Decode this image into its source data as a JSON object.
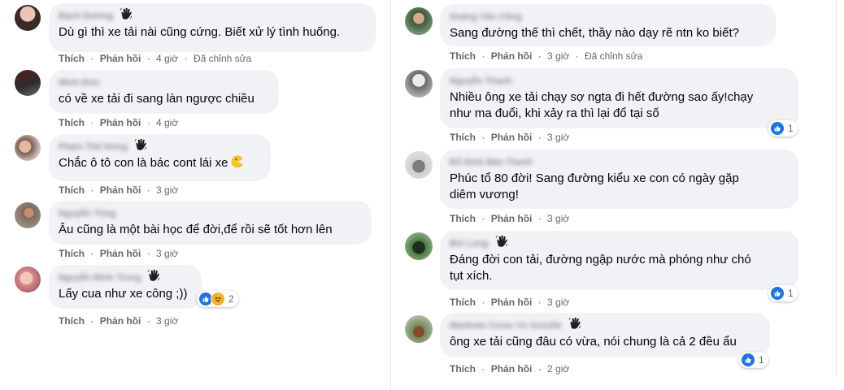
{
  "reactions_color": "#1b74e4",
  "left": [
    {
      "name": "Bạch Dương",
      "text": "Dù gì thì xe tải nài cũng cứng. Biết xử lý tình huống.",
      "like": "Thích",
      "reply": "Phản hồi",
      "time": "4 giờ",
      "edited": "Đã chỉnh sửa"
    },
    {
      "name": "Minh Đức",
      "text": "có về xe tải đi sang làn ngược chiều",
      "like": "Thích",
      "reply": "Phản hồi",
      "time": "4 giờ"
    },
    {
      "name": "Phạm Thế Hưng",
      "text": "Chắc ô tô con là bác cont lái xe",
      "like": "Thích",
      "reply": "Phản hồi",
      "time": "3 giờ"
    },
    {
      "name": "Nguyễn Tùng",
      "text": "Âu cũng là một bài học để đời,để rồi sẽ tốt hơn lên",
      "like": "Thích",
      "reply": "Phản hồi",
      "time": "3 giờ"
    },
    {
      "name": "Nguyễn Đình Trung",
      "text": "Lấy cua như xe công ;))",
      "like": "Thích",
      "reply": "Phản hồi",
      "time": "3 giờ",
      "reaction_count": "2"
    }
  ],
  "right": [
    {
      "name": "Hoàng Văn Công",
      "text": "Sang đường thế thì chết, thầy nào dạy rẽ ntn ko biết?",
      "like": "Thích",
      "reply": "Phản hồi",
      "time": "3 giờ",
      "edited": "Đã chỉnh sửa"
    },
    {
      "name": "Nguyễn Thanh",
      "text1": "Nhiều ông xe tải chạy sợ ngta đi hết đường sao ấy!chạy",
      "text2": "như ma đuổi, khi xảy ra thì lại đổ tại số",
      "like": "Thích",
      "reply": "Phản hồi",
      "time": "3 giờ",
      "reaction_count": "1"
    },
    {
      "name": "Đỗ Đình Bảo Thanh",
      "text1": "Phúc tổ 80 đời! Sang đường kiểu xe con có ngày gặp",
      "text2": "diêm vương!",
      "like": "Thích",
      "reply": "Phản hồi",
      "time": "3 giờ"
    },
    {
      "name": "Bùi Long",
      "text1": "Đáng đời con tải, đường ngập nước mà phóng như chó",
      "text2": "tụt xích.",
      "like": "Thích",
      "reply": "Phản hồi",
      "time": "3 giờ",
      "reaction_count": "1"
    },
    {
      "name": "Manhole Cover Vs Grizzlle",
      "text": "ông xe tải cũng đâu có vừa, nói chung là cả 2 đều ẩu",
      "like": "Thích",
      "reply": "Phản hồi",
      "time": "2 giờ",
      "reaction_count": "1"
    }
  ]
}
